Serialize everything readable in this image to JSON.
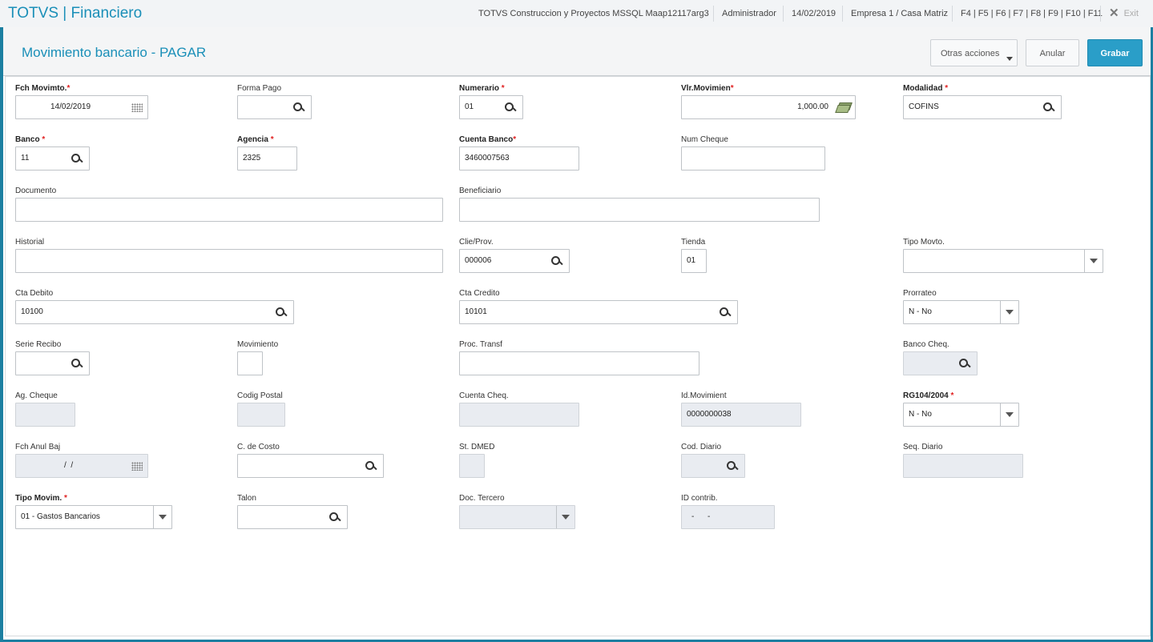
{
  "app": {
    "title": "TOTVS | Financiero",
    "environment": "TOTVS Construccion y Proyectos MSSQL Maap12117arg3",
    "user": "Administrador",
    "date": "14/02/2019",
    "company": "Empresa 1 / Casa Matriz",
    "shortcuts": "F4 | F5 | F6 | F7 | F8 | F9 | F10 | F11",
    "exit_label": "Exit"
  },
  "header": {
    "title": "Movimiento bancario - PAGAR",
    "more_actions": "Otras acciones",
    "cancel": "Anular",
    "save": "Grabar"
  },
  "fields": {
    "fch_movimto": {
      "label": "Fch Movimto.",
      "value": "14/02/2019"
    },
    "forma_pago": {
      "label": "Forma Pago",
      "value": ""
    },
    "numerario": {
      "label": "Numerario",
      "value": "01"
    },
    "vlr_movimien": {
      "label": "Vlr.Movimien",
      "value": "1,000.00"
    },
    "modalidad": {
      "label": "Modalidad",
      "value": "COFINS"
    },
    "banco": {
      "label": "Banco",
      "value": "11"
    },
    "agencia": {
      "label": "Agencia",
      "value": "2325"
    },
    "cuenta_banco": {
      "label": "Cuenta Banco",
      "value": "3460007563"
    },
    "num_cheque": {
      "label": "Num Cheque",
      "value": ""
    },
    "documento": {
      "label": "Documento",
      "value": ""
    },
    "beneficiario": {
      "label": "Beneficiario",
      "value": ""
    },
    "historial": {
      "label": "Historial",
      "value": ""
    },
    "clie_prov": {
      "label": "Clie/Prov.",
      "value": "000006"
    },
    "tienda": {
      "label": "Tienda",
      "value": "01"
    },
    "tipo_movto": {
      "label": "Tipo Movto.",
      "value": ""
    },
    "cta_debito": {
      "label": "Cta Debito",
      "value": "10100"
    },
    "cta_credito": {
      "label": "Cta Credito",
      "value": "10101"
    },
    "prorrateo": {
      "label": "Prorrateo",
      "value": "N - No"
    },
    "serie_recibo": {
      "label": "Serie Recibo",
      "value": ""
    },
    "movimiento": {
      "label": "Movimiento",
      "value": ""
    },
    "proc_transf": {
      "label": "Proc. Transf",
      "value": ""
    },
    "banco_cheq": {
      "label": "Banco Cheq.",
      "value": ""
    },
    "ag_cheque": {
      "label": "Ag. Cheque",
      "value": ""
    },
    "codig_postal": {
      "label": "Codig Postal",
      "value": ""
    },
    "cuenta_cheq": {
      "label": "Cuenta Cheq.",
      "value": ""
    },
    "id_movimient": {
      "label": "Id.Movimient",
      "value": "0000000038"
    },
    "rg104": {
      "label": "RG104/2004",
      "value": "N - No"
    },
    "fch_anul_baj": {
      "label": "Fch Anul Baj",
      "value": "/  /"
    },
    "c_de_costo": {
      "label": "C. de Costo",
      "value": ""
    },
    "st_dmed": {
      "label": "St. DMED",
      "value": ""
    },
    "cod_diario": {
      "label": "Cod. Diario",
      "value": ""
    },
    "seq_diario": {
      "label": "Seq. Diario",
      "value": ""
    },
    "tipo_movim": {
      "label": "Tipo Movim.",
      "value": "01 - Gastos Bancarios"
    },
    "talon": {
      "label": "Talon",
      "value": ""
    },
    "doc_tercero": {
      "label": "Doc. Tercero",
      "value": ""
    },
    "id_contrib": {
      "label": "ID contrib.",
      "value": "-      -"
    }
  },
  "required_marker": "*",
  "colors": {
    "accent": "#1a8fb8",
    "frame": "#1c7fa1",
    "save_button": "#2a9ec8",
    "required": "#e02020",
    "readonly_bg": "#e9ecf1"
  },
  "icons": {
    "lookup": "search-icon",
    "date": "calendar-icon",
    "amount": "money-icon",
    "select": "chevron-down-icon",
    "exit": "close-icon"
  }
}
